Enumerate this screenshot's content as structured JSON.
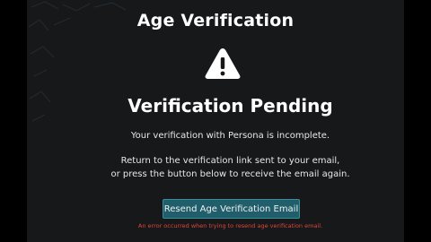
{
  "window": {
    "title": "Age Verification"
  },
  "status": {
    "heading": "Verification Pending",
    "subtext": "Your verification with Persona is incomplete.",
    "message_line1": "Return to the verification link sent to your email,",
    "message_line2": "or press the button below to receive the email again."
  },
  "actions": {
    "resend_label": "Resend Age Verification Email"
  },
  "error": {
    "text": "An error occurred when trying to resend age verification email."
  },
  "icons": {
    "status_icon": "warning-icon"
  },
  "colors": {
    "background": "#17181a",
    "button": "#1f5e6a",
    "button_border": "#3d8d99",
    "error": "#e0453a"
  }
}
